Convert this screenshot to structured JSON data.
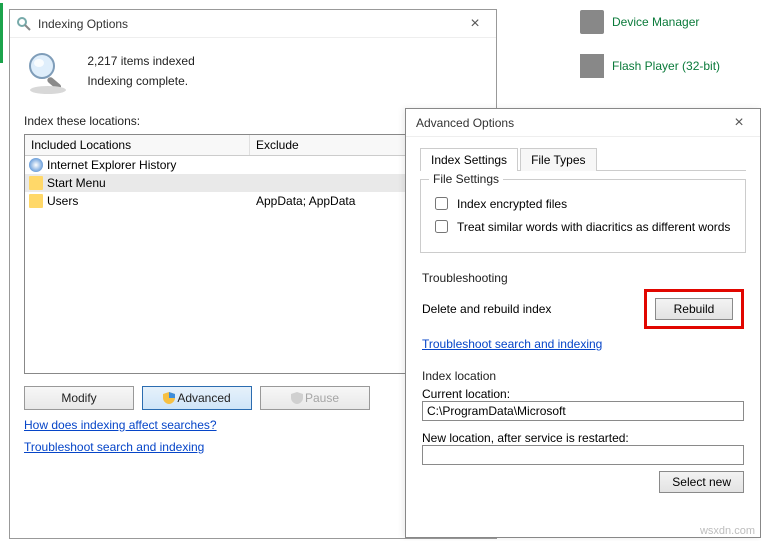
{
  "bg": {
    "device_manager": "Device Manager",
    "flash_player": "Flash Player (32-bit)"
  },
  "win1": {
    "title": "Indexing Options",
    "items_indexed": "2,217 items indexed",
    "status": "Indexing complete.",
    "locations_label": "Index these locations:",
    "cols": {
      "included": "Included Locations",
      "exclude": "Exclude"
    },
    "rows": [
      {
        "name": "Internet Explorer History",
        "exclude": "",
        "icon": "ie"
      },
      {
        "name": "Start Menu",
        "exclude": "",
        "icon": "folder",
        "selected": true
      },
      {
        "name": "Users",
        "exclude": "AppData; AppData",
        "icon": "folder"
      }
    ],
    "buttons": {
      "modify": "Modify",
      "advanced": "Advanced",
      "pause": "Pause"
    },
    "links": {
      "affect": "How does indexing affect searches?",
      "troubleshoot": "Troubleshoot search and indexing"
    }
  },
  "win2": {
    "title": "Advanced Options",
    "tabs": {
      "index_settings": "Index Settings",
      "file_types": "File Types"
    },
    "file_settings": {
      "label": "File Settings",
      "encrypted": "Index encrypted files",
      "diacritics": "Treat similar words with diacritics as different words"
    },
    "troubleshooting": {
      "label": "Troubleshooting",
      "delete_rebuild": "Delete and rebuild index",
      "rebuild": "Rebuild",
      "link": "Troubleshoot search and indexing"
    },
    "index_location": {
      "label": "Index location",
      "current_label": "Current location:",
      "current_value": "C:\\ProgramData\\Microsoft",
      "new_label": "New location, after service is restarted:",
      "new_value": "",
      "select_new": "Select new"
    }
  },
  "watermark": "wsxdn.com"
}
